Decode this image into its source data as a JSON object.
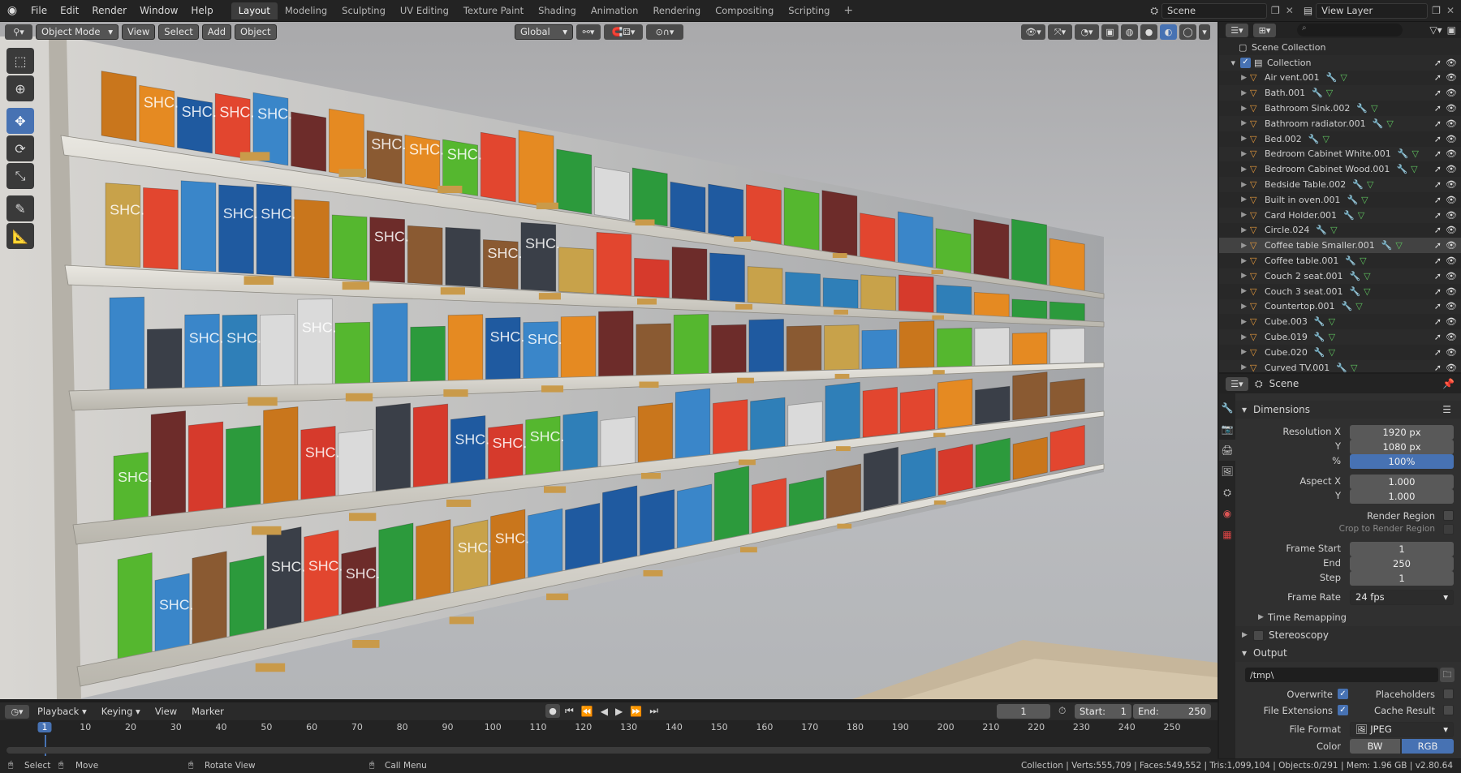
{
  "topbar": {
    "menus": [
      "File",
      "Edit",
      "Render",
      "Window",
      "Help"
    ],
    "workspaces": [
      "Layout",
      "Modeling",
      "Sculpting",
      "UV Editing",
      "Texture Paint",
      "Shading",
      "Animation",
      "Rendering",
      "Compositing",
      "Scripting"
    ],
    "active_workspace": "Layout",
    "scene_name": "Scene",
    "view_layer_name": "View Layer"
  },
  "viewport_header": {
    "mode": "Object Mode",
    "menus": [
      "View",
      "Select",
      "Add",
      "Object"
    ],
    "orientation": "Global"
  },
  "scene_content": {
    "brand_label": "SHC."
  },
  "outliner": {
    "root": "Scene Collection",
    "collection": "Collection",
    "items": [
      "Air vent.001",
      "Bath.001",
      "Bathroom Sink.002",
      "Bathroom radiator.001",
      "Bed.002",
      "Bedroom Cabinet White.001",
      "Bedroom Cabinet Wood.001",
      "Bedside Table.002",
      "Built in oven.001",
      "Card Holder.001",
      "Circle.024",
      "Coffee table Smaller.001",
      "Coffee table.001",
      "Couch 2 seat.001",
      "Couch 3 seat.001",
      "Countertop.001",
      "Cube.003",
      "Cube.019",
      "Cube.020",
      "Curved TV.001"
    ],
    "selected_index": 11
  },
  "properties": {
    "context": "Scene",
    "dimensions": {
      "title": "Dimensions",
      "resolution_x_label": "Resolution X",
      "resolution_x": "1920 px",
      "y_label": "Y",
      "resolution_y": "1080 px",
      "pct_label": "%",
      "resolution_pct": "100%",
      "aspect_x_label": "Aspect X",
      "aspect_x": "1.000",
      "aspect_y": "1.000",
      "render_region": "Render Region",
      "crop_region": "Crop to Render Region",
      "frame_start_label": "Frame Start",
      "frame_start": "1",
      "end_label": "End",
      "frame_end": "250",
      "step_label": "Step",
      "step": "1",
      "frame_rate_label": "Frame Rate",
      "frame_rate": "24 fps",
      "time_remapping": "Time Remapping"
    },
    "stereoscopy": "Stereoscopy",
    "output": {
      "title": "Output",
      "path": "/tmp\\",
      "overwrite": "Overwrite",
      "placeholders": "Placeholders",
      "file_extensions": "File Extensions",
      "cache_result": "Cache Result",
      "file_format_label": "File Format",
      "file_format": "JPEG",
      "color_label": "Color",
      "color_bw": "BW",
      "color_rgb": "RGB"
    }
  },
  "timeline": {
    "menus": [
      "Playback",
      "Keying",
      "View",
      "Marker"
    ],
    "current_frame": "1",
    "start_label": "Start:",
    "start": "1",
    "end_label": "End:",
    "end": "250",
    "ticks": [
      "1",
      "10",
      "20",
      "30",
      "40",
      "50",
      "60",
      "70",
      "80",
      "90",
      "100",
      "110",
      "120",
      "130",
      "140",
      "150",
      "160",
      "170",
      "180",
      "190",
      "200",
      "210",
      "220",
      "230",
      "240",
      "250"
    ]
  },
  "statusbar": {
    "select": "Select",
    "move": "Move",
    "rotate_view": "Rotate View",
    "call_menu": "Call Menu",
    "stats": "Collection | Verts:555,709 | Faces:549,552 | Tris:1,099,104 | Objects:0/291 | Mem: 1.96 GB | v2.80.64"
  },
  "colors": {
    "accent": "#4772b3",
    "panel": "#303030",
    "header": "#232323"
  }
}
